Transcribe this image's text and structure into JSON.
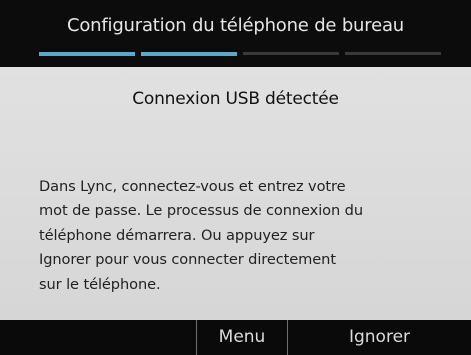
{
  "header": {
    "title": "Configuration du téléphone de bureau",
    "progress": {
      "steps_total": 4,
      "steps_completed": 2
    }
  },
  "dialog": {
    "title": "Connexion USB détectée",
    "message": "Dans Lync, connectez-vous et entrez votre\nmot de passe. Le processus de connexion du\ntéléphone démarrera. Ou appuyez sur\nIgnorer pour vous connecter directement\nsur le téléphone."
  },
  "softkeys": {
    "left_label": "",
    "menu_label": "Menu",
    "ignore_label": "Ignorer"
  },
  "colors": {
    "header_bg": "#0c0c0c",
    "accent": "#5aa9c8",
    "panel_bg": "#dcdcdc",
    "softkey_bar_bg": "#0a0a0a"
  }
}
